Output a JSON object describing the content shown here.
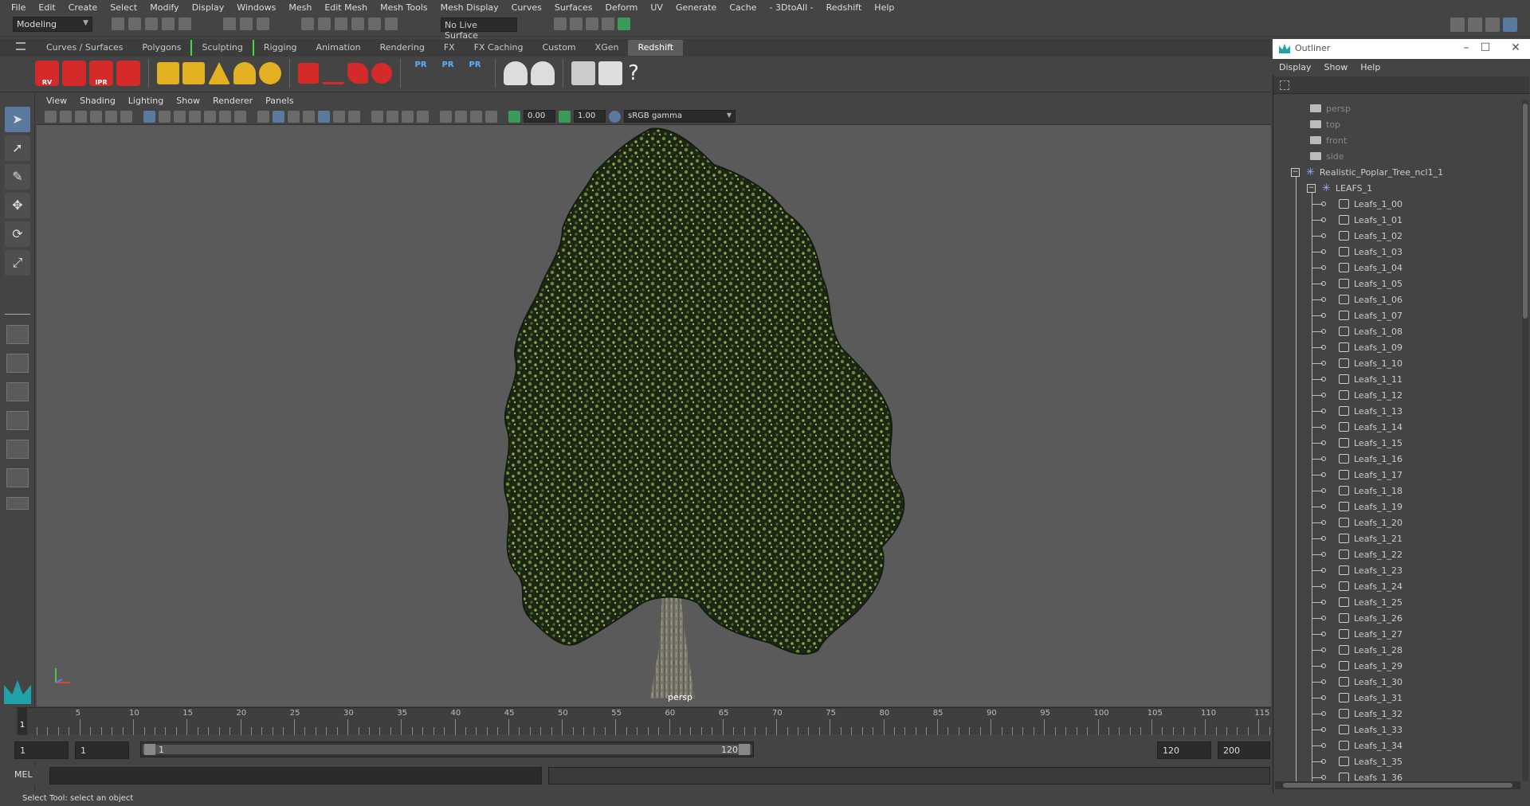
{
  "menubar": [
    "File",
    "Edit",
    "Create",
    "Select",
    "Modify",
    "Display",
    "Windows",
    "Mesh",
    "Edit Mesh",
    "Mesh Tools",
    "Mesh Display",
    "Curves",
    "Surfaces",
    "Deform",
    "UV",
    "Generate",
    "Cache",
    "- 3DtoAll -",
    "Redshift",
    "Help"
  ],
  "status": {
    "mode": "Modeling",
    "live_surface": "No Live Surface"
  },
  "shelf_tabs": [
    "Curves / Surfaces",
    "Polygons",
    "Sculpting",
    "Rigging",
    "Animation",
    "Rendering",
    "FX",
    "FX Caching",
    "Custom",
    "XGen",
    "Redshift"
  ],
  "shelf_active": "Redshift",
  "shelf_labels": {
    "rv": "RV",
    "ipr": "IPR",
    "pr1": "PR",
    "pr2": "PR",
    "pr3": "PR",
    "help": "?"
  },
  "panel_menu": [
    "View",
    "Shading",
    "Lighting",
    "Show",
    "Renderer",
    "Panels"
  ],
  "panel_tools": {
    "exposure": "0.00",
    "gamma": "1.00",
    "color_space": "sRGB gamma"
  },
  "viewport": {
    "camera_label": "persp"
  },
  "timeline": {
    "current_frame": "1",
    "ticks": [
      "5",
      "10",
      "15",
      "20",
      "25",
      "30",
      "35",
      "40",
      "45",
      "50",
      "55",
      "60",
      "65",
      "70",
      "75",
      "80",
      "85",
      "90",
      "95",
      "100",
      "105",
      "110",
      "115"
    ]
  },
  "range": {
    "start": "1",
    "playback_start": "1",
    "slider_start": "1",
    "slider_end": "120",
    "playback_end": "120",
    "end": "200"
  },
  "cmdline": {
    "label": "MEL"
  },
  "helpline": "Select Tool: select an object",
  "outliner": {
    "title": "Outliner",
    "window_buttons": [
      "–",
      "☐",
      "✕"
    ],
    "menu": [
      "Display",
      "Show",
      "Help"
    ],
    "cameras": [
      "persp",
      "top",
      "front",
      "side"
    ],
    "root": "Realistic_Poplar_Tree_ncl1_1",
    "group": "LEAFS_1",
    "toggle_minus": "−",
    "leafs": [
      "Leafs_1_00",
      "Leafs_1_01",
      "Leafs_1_02",
      "Leafs_1_03",
      "Leafs_1_04",
      "Leafs_1_05",
      "Leafs_1_06",
      "Leafs_1_07",
      "Leafs_1_08",
      "Leafs_1_09",
      "Leafs_1_10",
      "Leafs_1_11",
      "Leafs_1_12",
      "Leafs_1_13",
      "Leafs_1_14",
      "Leafs_1_15",
      "Leafs_1_16",
      "Leafs_1_17",
      "Leafs_1_18",
      "Leafs_1_19",
      "Leafs_1_20",
      "Leafs_1_21",
      "Leafs_1_22",
      "Leafs_1_23",
      "Leafs_1_24",
      "Leafs_1_25",
      "Leafs_1_26",
      "Leafs_1_27",
      "Leafs_1_28",
      "Leafs_1_29",
      "Leafs_1_30",
      "Leafs_1_31",
      "Leafs_1_32",
      "Leafs_1_33",
      "Leafs_1_34",
      "Leafs_1_35",
      "Leafs_1_36"
    ]
  },
  "colors": {
    "accent_active": "#5a7aa0",
    "maya_teal": "#1fa3a8",
    "redshift_red": "#d42a2a",
    "shelf_mark": "#3dde3d"
  }
}
